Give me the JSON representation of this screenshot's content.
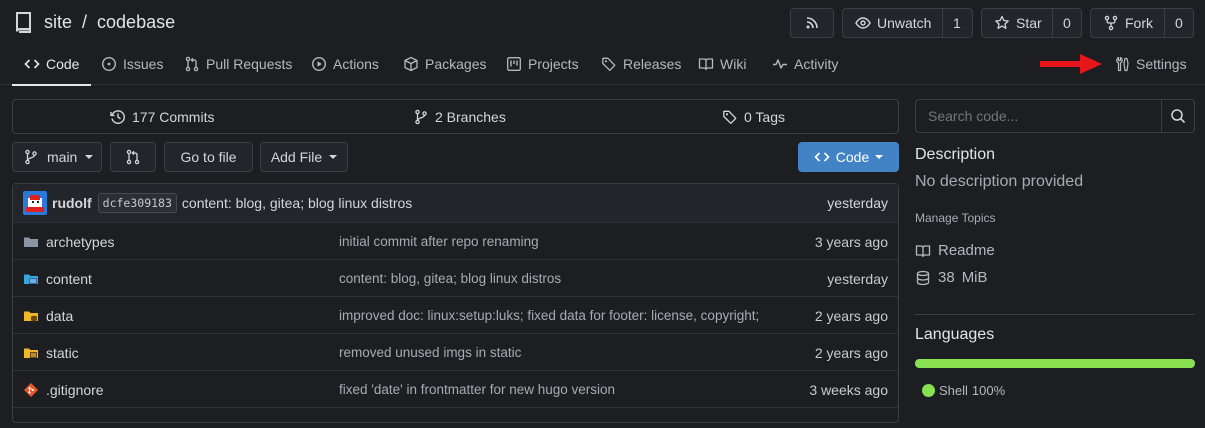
{
  "repo": {
    "owner": "site",
    "separator": "/",
    "name": "codebase"
  },
  "actions": {
    "unwatch_label": "Unwatch",
    "watch_count": "1",
    "star_label": "Star",
    "star_count": "0",
    "fork_label": "Fork",
    "fork_count": "0"
  },
  "tabs": [
    {
      "label": "Code"
    },
    {
      "label": "Issues"
    },
    {
      "label": "Pull Requests"
    },
    {
      "label": "Actions"
    },
    {
      "label": "Packages"
    },
    {
      "label": "Projects"
    },
    {
      "label": "Releases"
    },
    {
      "label": "Wiki"
    },
    {
      "label": "Activity"
    },
    {
      "label": "Settings"
    }
  ],
  "stats": {
    "commits": "177 Commits",
    "branches": "2 Branches",
    "tags": "0 Tags"
  },
  "toolbar": {
    "branch": "main",
    "go_to_file": "Go to file",
    "add_file": "Add File",
    "code_button": "Code"
  },
  "latest_commit": {
    "author": "rudolf",
    "sha": "dcfe309183",
    "message": "content: blog, gitea; blog linux distros",
    "age": "yesterday"
  },
  "files": [
    {
      "name": "archetypes",
      "message": "initial commit after repo renaming",
      "age": "3 years ago",
      "icon": "folder-icon"
    },
    {
      "name": "content",
      "message": "content: blog, gitea; blog linux distros",
      "age": "yesterday",
      "icon": "folder-content-icon"
    },
    {
      "name": "data",
      "message": "improved doc: linux:setup:luks; fixed data for footer: license, copyright;",
      "age": "2 years ago",
      "icon": "folder-data-icon"
    },
    {
      "name": "static",
      "message": "removed unused imgs in static",
      "age": "2 years ago",
      "icon": "folder-static-icon"
    },
    {
      "name": ".gitignore",
      "message": "fixed 'date' in frontmatter for new hugo version",
      "age": "3 weeks ago",
      "icon": "git-icon"
    }
  ],
  "sidebar": {
    "search_placeholder": "Search code...",
    "description_title": "Description",
    "description_text": "No description provided",
    "manage_topics": "Manage Topics",
    "readme": "Readme",
    "size_value": "38",
    "size_unit": "MiB",
    "languages_title": "Languages",
    "language": {
      "name": "Shell",
      "percent": "100%",
      "fraction": 1.0,
      "color": "#89e051"
    }
  },
  "colors": {
    "accent": "#4183c4",
    "annotation_arrow": "#e8161b"
  }
}
